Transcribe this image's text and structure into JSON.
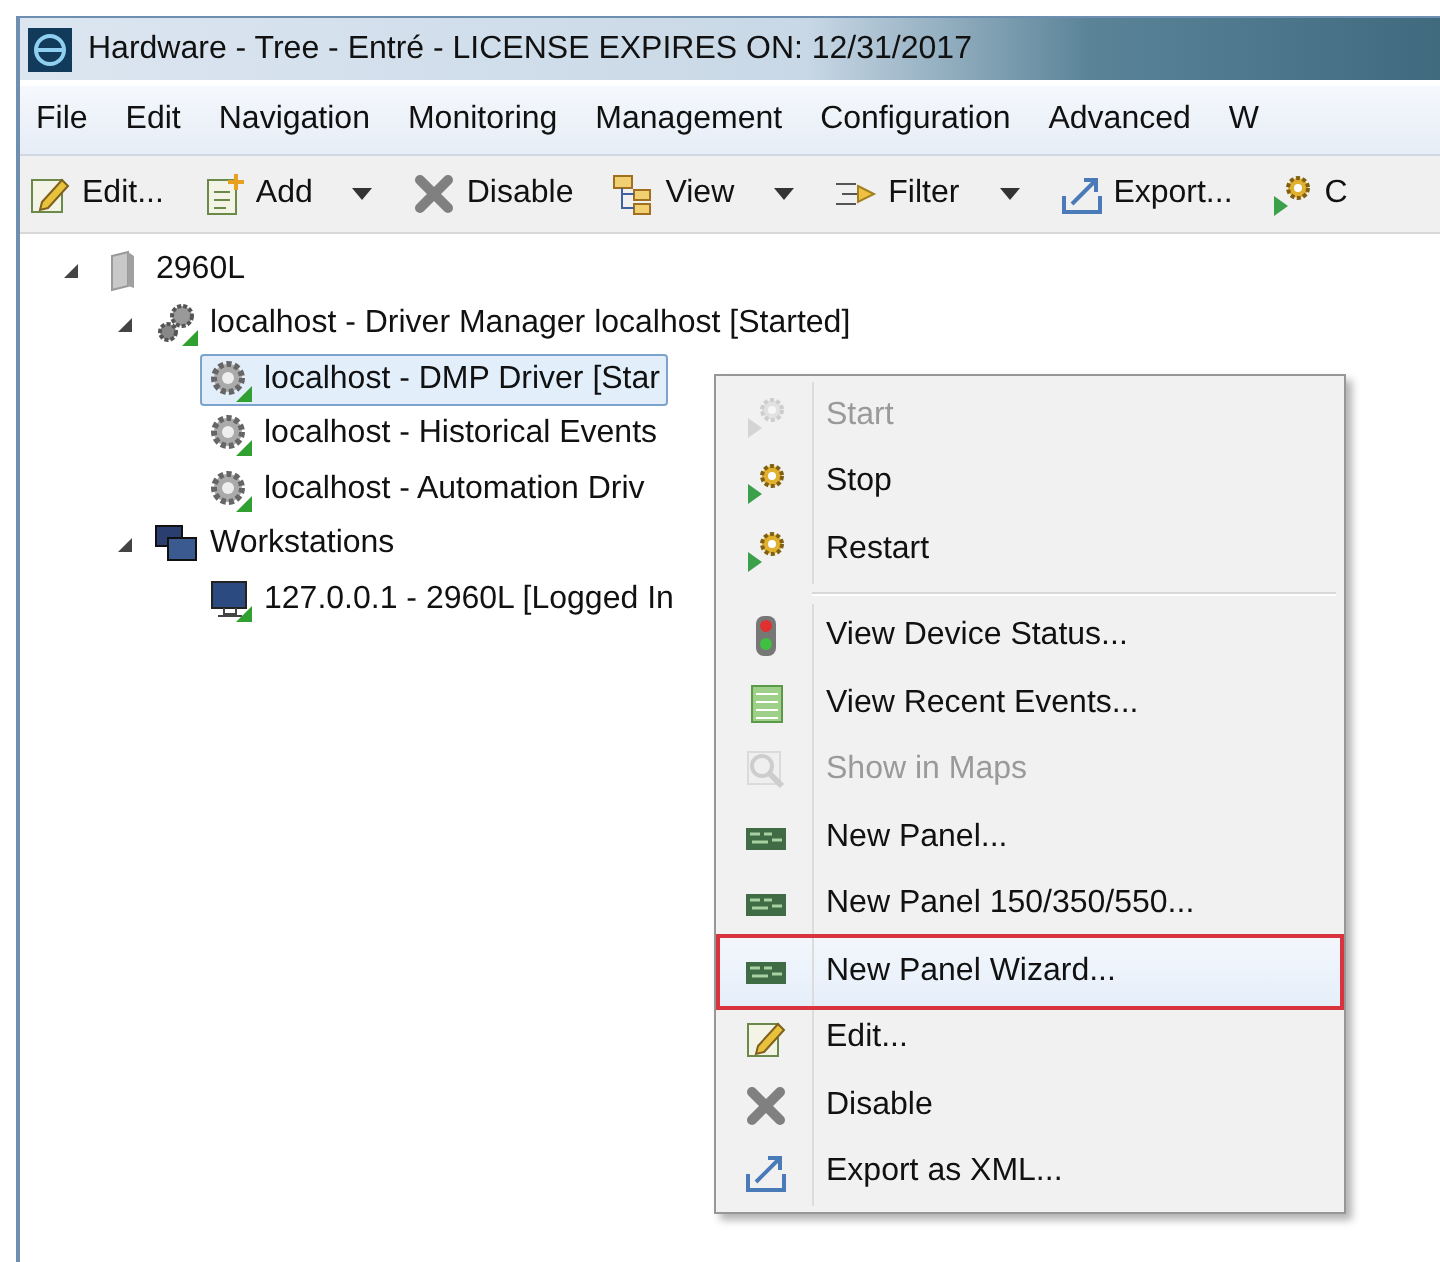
{
  "window": {
    "title": "Hardware - Tree - Entré - LICENSE EXPIRES ON: 12/31/2017"
  },
  "menu_bar": [
    "File",
    "Edit",
    "Navigation",
    "Monitoring",
    "Management",
    "Configuration",
    "Advanced",
    "W"
  ],
  "toolbar": [
    {
      "label": "Edit...",
      "kind": "edit",
      "dropdown": false
    },
    {
      "label": "Add",
      "kind": "add",
      "dropdown": true
    },
    {
      "label": "Disable",
      "kind": "disable",
      "dropdown": false
    },
    {
      "label": "View",
      "kind": "view",
      "dropdown": true
    },
    {
      "label": "Filter",
      "kind": "filter",
      "dropdown": true
    },
    {
      "label": "Export...",
      "kind": "export",
      "dropdown": false
    },
    {
      "label": "C",
      "kind": "restart",
      "dropdown": false
    }
  ],
  "tree": [
    {
      "label": "2960L",
      "kind": "device",
      "expanded": true,
      "selected": false,
      "children": [
        {
          "label": "localhost - Driver Manager localhost [Started]",
          "kind": "manager",
          "expanded": true,
          "selected": false,
          "children": [
            {
              "label": "localhost - DMP Driver [Star",
              "kind": "driver",
              "selected": true
            },
            {
              "label": "localhost - Historical Events",
              "kind": "driver",
              "selected": false
            },
            {
              "label": "localhost - Automation Driv",
              "kind": "driver",
              "selected": false
            }
          ]
        },
        {
          "label": "Workstations",
          "kind": "group",
          "expanded": true,
          "selected": false,
          "children": [
            {
              "label": "127.0.0.1 - 2960L [Logged In",
              "kind": "workstation",
              "selected": false
            }
          ]
        }
      ]
    }
  ],
  "context_menu": [
    [
      {
        "label": "Start",
        "kind": "start",
        "disabled": true,
        "selected": false
      },
      {
        "label": "Stop",
        "kind": "restart",
        "disabled": false,
        "selected": false
      },
      {
        "label": "Restart",
        "kind": "restart",
        "disabled": false,
        "selected": false
      }
    ],
    [
      {
        "label": "View Device Status...",
        "kind": "status",
        "disabled": false,
        "selected": false
      },
      {
        "label": "View Recent Events...",
        "kind": "events",
        "disabled": false,
        "selected": false
      },
      {
        "label": "Show in Maps",
        "kind": "maps",
        "disabled": true,
        "selected": false
      },
      {
        "label": "New Panel...",
        "kind": "panel",
        "disabled": false,
        "selected": false
      },
      {
        "label": "New Panel 150/350/550...",
        "kind": "panel",
        "disabled": false,
        "selected": false
      },
      {
        "label": "New Panel Wizard...",
        "kind": "panel",
        "disabled": false,
        "selected": true
      },
      {
        "label": "Edit...",
        "kind": "edit",
        "disabled": false,
        "selected": false
      },
      {
        "label": "Disable",
        "kind": "disable",
        "disabled": false,
        "selected": false
      },
      {
        "label": "Export as XML...",
        "kind": "export",
        "disabled": false,
        "selected": false
      }
    ]
  ]
}
